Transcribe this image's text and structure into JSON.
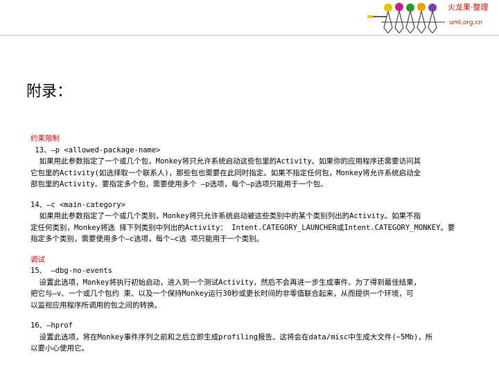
{
  "header": {
    "brand": "火龙果·整理",
    "url": "uml.org.cn",
    "logo_icon": "people-tree-logo-icon",
    "accent": "#cc1100"
  },
  "page": {
    "title": "附录："
  },
  "sections": {
    "constraints_title": "约束限制",
    "p13": {
      "head": " 13、—p <allowed-package-name>",
      "l1": "  如果用此参数指定了一个或几个包，Monkey将只允许系统启动这些包里的Activity。如果你的应用程序还需要访问其",
      "l2": "它包里的Activity(如选择取一个联系人)，那些包也需要在此同时指定。如果不指定任何包，Monkey将允许系统启动全",
      "l3": "部包里的Activity。要指定多个包，需要使用多个 —p选项，每个—p选项只能用于一个包。"
    },
    "p14": {
      "head": "14、—c <main-category>",
      "l1": "  如果用此参数指定了一个或几个类别，Monkey将只允许系统启动被这些类别中的某个类别列出的Activity。如果不指",
      "l2": "定任何类别，Monkey将选 择下列类别中列出的Activity： Intent.CATEGORY_LAUNCHER或Intent.CATEGORY_MONKEY。要",
      "l3": "指定多个类别，需要使用多个—c选项，每个—c选 项只能用于一个类别。"
    },
    "debug_title": "调试",
    "p15": {
      "head": "15、 —dbg-no-events",
      "l1": "  设置此选项，Monkey将执行初始启动，进入到一个测试Activity，然后不会再进一步生成事件。为了得到最佳结果，",
      "l2": "把它与—v、一个或几个包约 束、以及一个保持Monkey运行30秒或更长时间的非零值联合起来，从而提供一个环境，可",
      "l3": "以监视应用程序所调用的包之间的转换。"
    },
    "p16": {
      "head": "16、—hprof",
      "l1": "  设置此选项，将在Monkey事件序列之前和之后立即生成profiling报告。这将会在data/misc中生成大文件(~5Mb)，所",
      "l2": "以要小心使用它。"
    }
  }
}
